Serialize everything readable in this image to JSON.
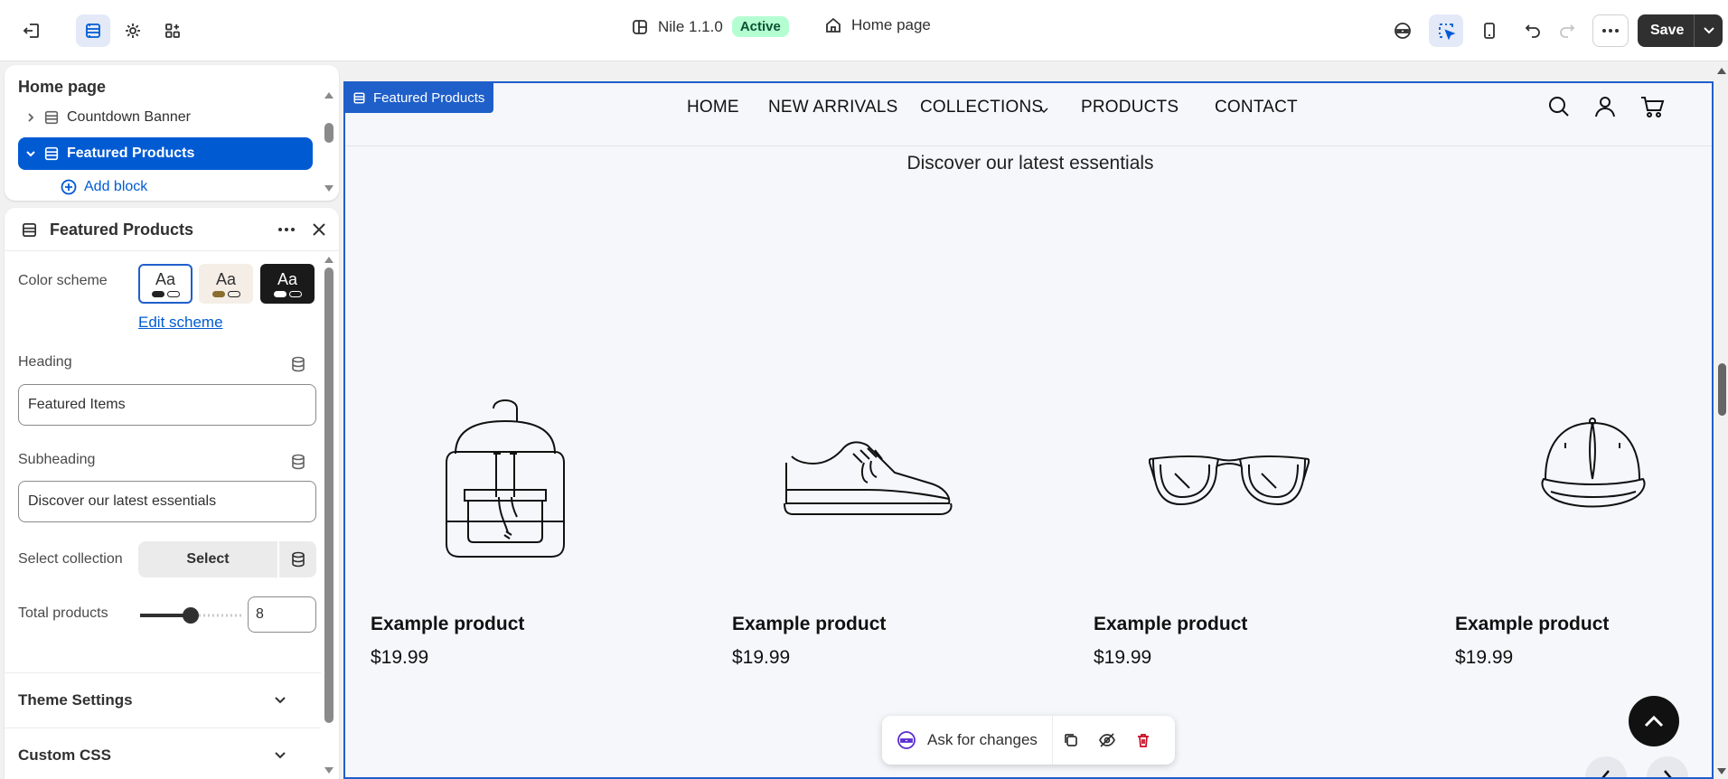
{
  "topbar": {
    "theme_name": "Nile 1.1.0",
    "theme_status": "Active",
    "page_name": "Home page",
    "save_label": "Save"
  },
  "tree": {
    "title": "Home page",
    "items": [
      {
        "label": "Countdown Banner"
      },
      {
        "label": "Featured Products"
      }
    ],
    "add_block": "Add block"
  },
  "settings": {
    "title": "Featured Products",
    "color_scheme_label": "Color scheme",
    "swatch_text": "Aa",
    "edit_scheme": "Edit scheme",
    "heading_label": "Heading",
    "heading_value": "Featured Items",
    "subheading_label": "Subheading",
    "subheading_value": "Discover our latest essentials",
    "collection_label": "Select collection",
    "select_label": "Select",
    "total_label": "Total products",
    "total_value": "8",
    "total_fraction": 0.5,
    "sections": [
      "Theme Settings",
      "Custom CSS"
    ]
  },
  "preview": {
    "tag": "Featured Products",
    "nav": [
      "HOME",
      "NEW ARRIVALS",
      "COLLECTIONS",
      "PRODUCTS",
      "CONTACT"
    ],
    "subheading": "Discover our latest essentials",
    "products": [
      {
        "name": "Example product",
        "price": "$19.99",
        "icon": "backpack-icon"
      },
      {
        "name": "Example product",
        "price": "$19.99",
        "icon": "sneaker-icon"
      },
      {
        "name": "Example product",
        "price": "$19.99",
        "icon": "sunglasses-icon"
      },
      {
        "name": "Example product",
        "price": "$19.99",
        "icon": "cap-icon"
      }
    ]
  },
  "floating_toolbar": {
    "ask_label": "Ask for changes"
  },
  "colors": {
    "accent": "#005bd3",
    "preview_outline": "#1f5fc9",
    "active_badge_bg": "#b4fed2",
    "save_bg": "#303030"
  }
}
